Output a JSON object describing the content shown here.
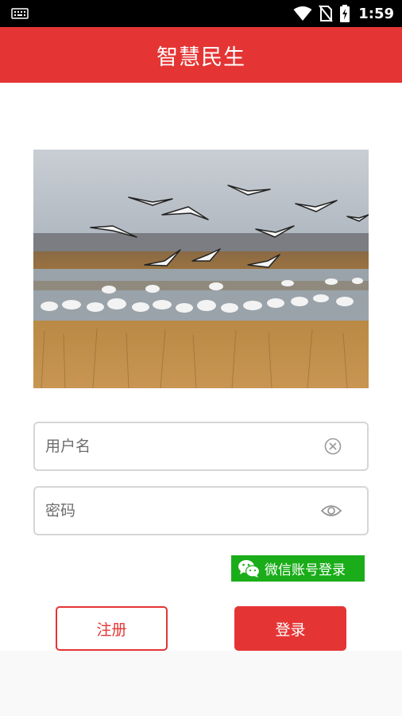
{
  "status_bar": {
    "time": "1:59",
    "icons": [
      "keyboard-icon",
      "wifi-icon",
      "no-sim-icon",
      "battery-charging-icon"
    ]
  },
  "app_bar": {
    "title": "智慧民生"
  },
  "hero": {
    "description_icon": "hero-image"
  },
  "login_form": {
    "username": {
      "placeholder": "用户名",
      "value": "",
      "icon": "clear-icon"
    },
    "password": {
      "placeholder": "密码",
      "value": "",
      "icon": "eye-icon"
    }
  },
  "wechat_login": {
    "label": "微信账号登录",
    "icon": "wechat-icon"
  },
  "buttons": {
    "register_label": "注册",
    "login_label": "登录"
  },
  "colors": {
    "primary": "#e43534",
    "wechat_green": "#1aad19",
    "status_bar": "#000000"
  }
}
